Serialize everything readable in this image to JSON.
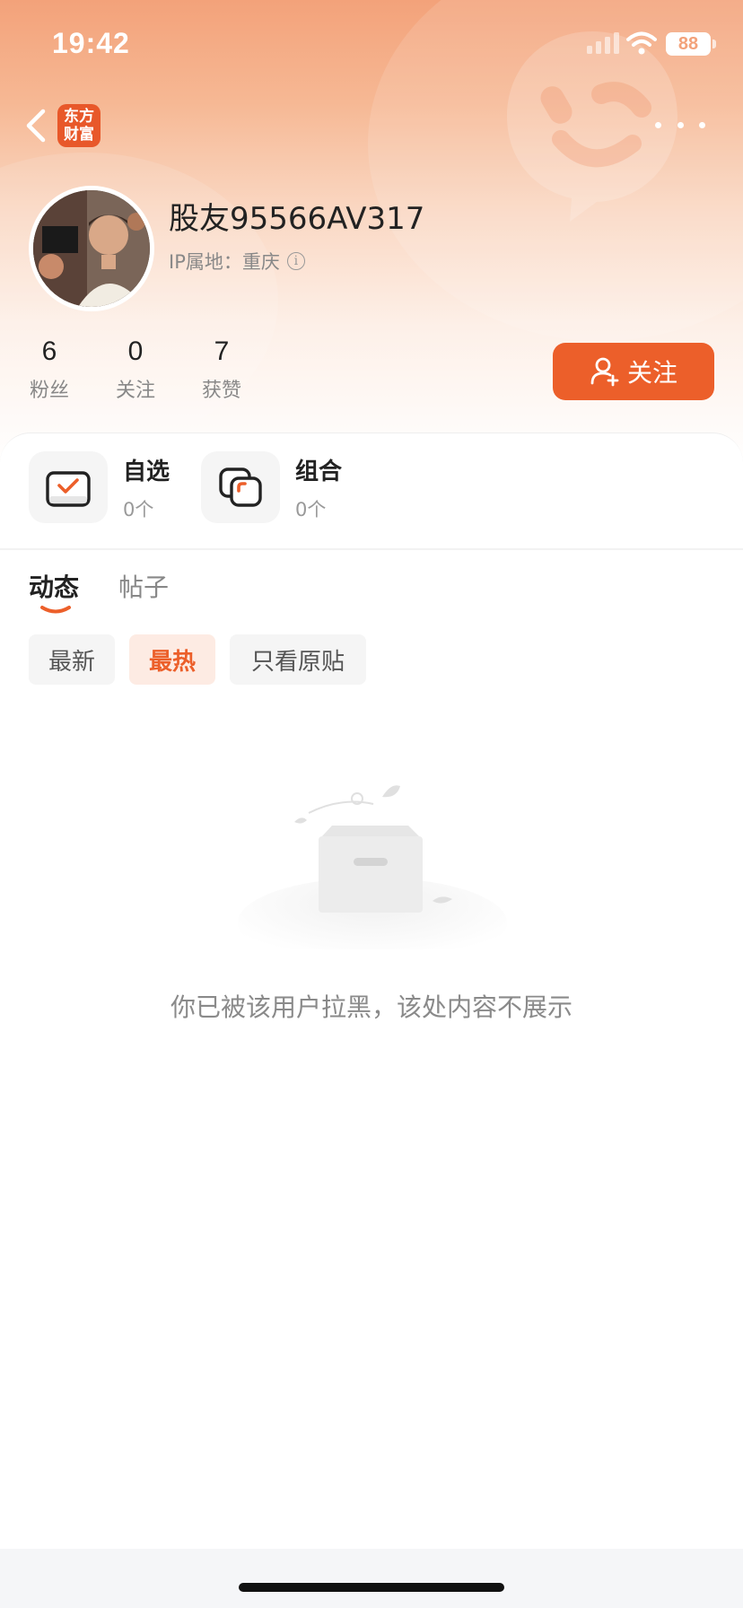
{
  "status_bar": {
    "time": "19:42",
    "battery": "88"
  },
  "nav": {
    "logo_line1": "东方",
    "logo_line2": "财富"
  },
  "profile": {
    "username": "股友95566AV317",
    "ip_label": "IP属地：",
    "ip_location": "重庆",
    "stats": [
      {
        "value": "6",
        "label": "粉丝"
      },
      {
        "value": "0",
        "label": "关注"
      },
      {
        "value": "7",
        "label": "获赞"
      }
    ],
    "follow_label": "关注"
  },
  "shortcuts": [
    {
      "title": "自选",
      "count": "0个"
    },
    {
      "title": "组合",
      "count": "0个"
    }
  ],
  "tabs": [
    {
      "label": "动态",
      "active": true
    },
    {
      "label": "帖子",
      "active": false
    }
  ],
  "filters": [
    {
      "label": "最新",
      "active": false
    },
    {
      "label": "最热",
      "active": true
    },
    {
      "label": "只看原贴",
      "active": false
    }
  ],
  "empty_state": {
    "message": "你已被该用户拉黑，该处内容不展示"
  },
  "colors": {
    "accent": "#ec5f2a",
    "header_gradient_top": "#f3a27a",
    "filter_active_bg": "#fdebe3"
  }
}
